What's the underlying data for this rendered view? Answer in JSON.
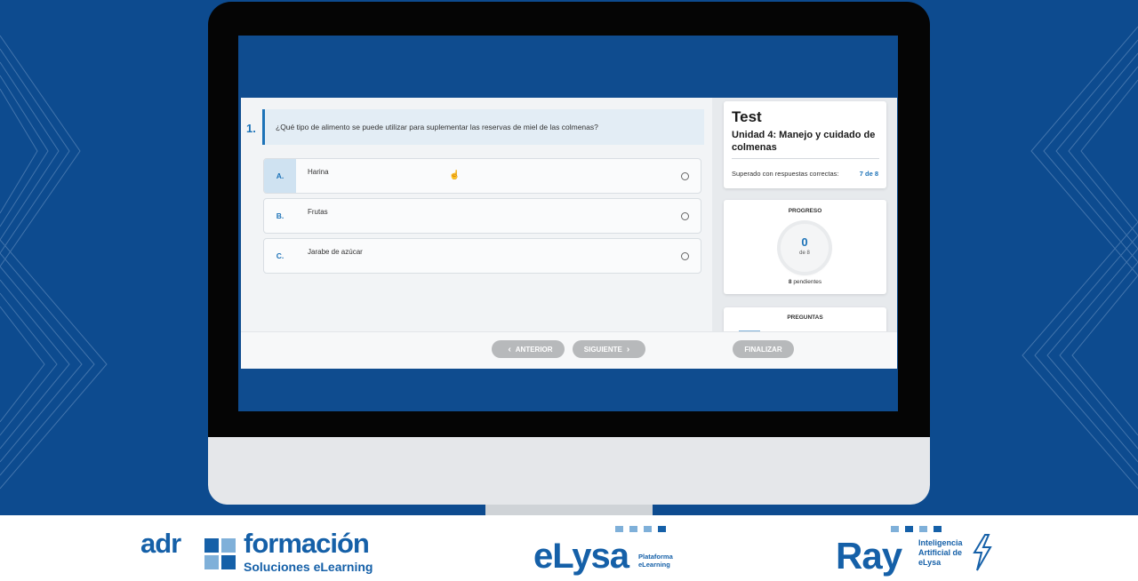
{
  "question": {
    "number": "1.",
    "text": "¿Qué tipo de alimento se puede utilizar para suplementar las reservas de miel de las colmenas?",
    "options": [
      {
        "letter": "A.",
        "text": "Harina"
      },
      {
        "letter": "B.",
        "text": "Frutas"
      },
      {
        "letter": "C.",
        "text": "Jarabe de azúcar"
      }
    ]
  },
  "sidebar": {
    "title": "Test",
    "unit": "Unidad 4: Manejo y cuidado de colmenas",
    "pass_label": "Superado con respuestas correctas:",
    "pass_value": "7 de 8",
    "progress": {
      "title": "PROGRESO",
      "answered": "0",
      "total_label": "de 8",
      "pending_count": "8",
      "pending_label": "pendientes"
    },
    "questions_title": "PREGUNTAS"
  },
  "nav": {
    "prev_label": "ANTERIOR",
    "next_label": "SIGUIENTE",
    "finish_label": "FINALIZAR"
  },
  "footer": {
    "adr": {
      "word": "adr",
      "formacion": "formación",
      "tagline": "Soluciones eLearning"
    },
    "elysa": {
      "word": "eLysa",
      "tag1": "Plataforma",
      "tag2": "eLearning"
    },
    "ray": {
      "word": "Ray",
      "tag1": "Inteligencia",
      "tag2": "Artificial de",
      "tag3": "eLysa"
    }
  },
  "colors": {
    "brand_blue": "#1560a8",
    "background_blue": "#0d4b8f",
    "accent": "#1d73b8",
    "button_grey": "#b7b9bb"
  },
  "icons": [
    "chevron-left-icon",
    "chevron-right-icon",
    "hand-cursor-icon",
    "lightning-bolt-icon"
  ]
}
